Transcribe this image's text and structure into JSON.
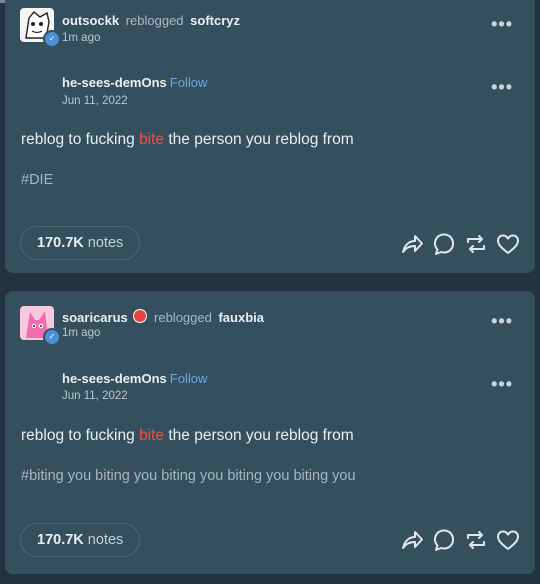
{
  "posts": [
    {
      "reblogger": "outsockk",
      "reblogged_word": "reblogged",
      "reblogged_from": "softcryz",
      "time": "1m ago",
      "source_user": "he-sees-demOns",
      "follow_label": "Follow",
      "source_date": "Jun 11, 2022",
      "text_before": "reblog to fucking",
      "text_highlight": "bite",
      "text_after": "the person you reblog from",
      "tags": "#DIE",
      "notes_count": "170.7K",
      "notes_label": "notes"
    },
    {
      "reblogger": "soaricarus",
      "reblogged_word": "reblogged",
      "reblogged_from": "fauxbia",
      "time": "1m ago",
      "source_user": "he-sees-demOns",
      "follow_label": "Follow",
      "source_date": "Jun 11, 2022",
      "text_before": "reblog to fucking",
      "text_highlight": "bite",
      "text_after": "the person you reblog from",
      "tags": "#biting you biting you biting you biting you biting you",
      "notes_count": "170.7K",
      "notes_label": "notes"
    }
  ],
  "menu_glyph": "•••",
  "icons": [
    "share-icon",
    "reply-icon",
    "reblog-icon",
    "like-icon"
  ],
  "colors": {
    "background": "#243342",
    "card": "#34505e",
    "highlight": "#ff4a3a",
    "link": "#6fa8e0"
  }
}
